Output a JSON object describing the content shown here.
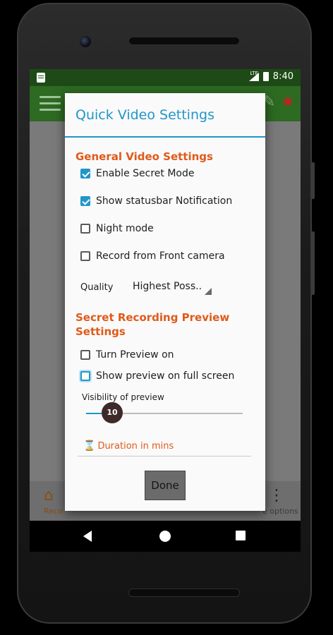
{
  "status_bar": {
    "network": "LTE",
    "time": "8:40"
  },
  "bottom_nav": {
    "record_label": "Reco",
    "more_options_label": "e options"
  },
  "dialog": {
    "title": "Quick Video Settings",
    "general_section": "General Video Settings",
    "options": [
      {
        "label": "Enable Secret Mode",
        "checked": true
      },
      {
        "label": "Show statusbar Notification",
        "checked": true
      },
      {
        "label": "Night mode",
        "checked": false
      },
      {
        "label": "Record from Front camera",
        "checked": false
      }
    ],
    "quality_label": "Quality",
    "quality_value": "Highest Poss..",
    "preview_section_line1": "Secret Recording Preview",
    "preview_section_line2": "Settings",
    "preview_options": [
      {
        "label": "Turn Preview on",
        "checked": false
      },
      {
        "label": "Show preview on full screen",
        "checked": false
      }
    ],
    "visibility_label": "Visibility of preview",
    "visibility_value": "10",
    "visibility_fraction": 0.1,
    "duration_placeholder": "Duration in mins",
    "done_label": "Done"
  },
  "icons": {
    "home": "home-icon",
    "more": "more-vert-icon",
    "star": "star-icon",
    "edit": "edit-icon",
    "hourglass": "hourglass-icon"
  },
  "colors": {
    "accent": "#2196c9",
    "section": "#e05a1a",
    "appbar": "#2d6a22",
    "statusbar": "#1d4a16",
    "slider_thumb": "#3e2a28"
  }
}
